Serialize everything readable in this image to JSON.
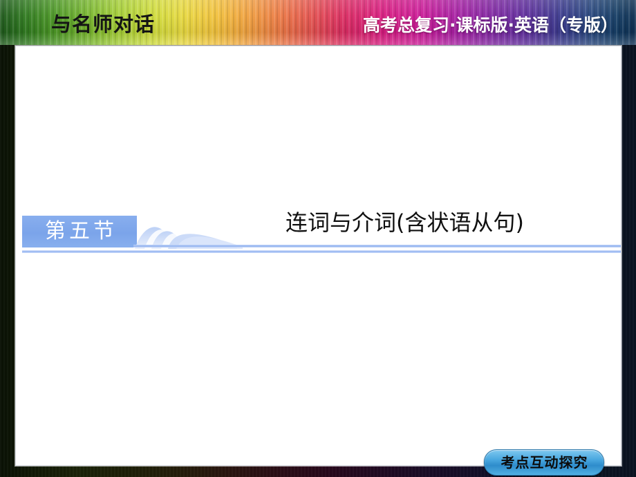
{
  "header": {
    "brand": "与名师对话",
    "course": "高考总复习·课标版·英语（专版）",
    "gradient_start": "#1f5a1c",
    "gradient_end": "#0d2f52"
  },
  "section": {
    "chip_label": "第五节",
    "title": "连词与介词(含状语从句)",
    "chip_color": "#7ba4ea",
    "rule_color": "#90b1f0",
    "deco_icon": "arch-swoosh-icon"
  },
  "footer": {
    "action_label": "考点互动探究",
    "action_color": "#2e8ccb"
  }
}
